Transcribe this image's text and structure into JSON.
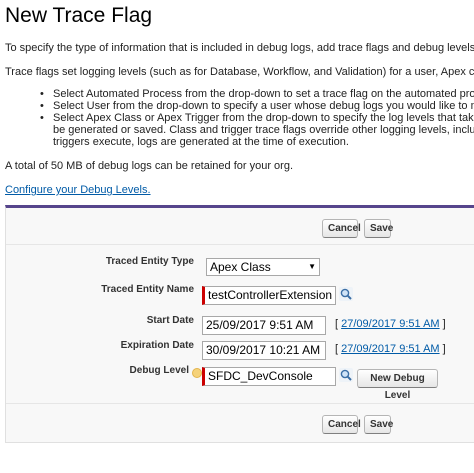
{
  "page": {
    "title": "New Trace Flag",
    "intro": "To specify the type of information that is included in debug logs, add trace flags and debug levels. Ea",
    "trace_intro": "Trace flags set logging levels (such as for Database, Workflow, and Validation) for a user, Apex class",
    "bullets": [
      "Select Automated Process from the drop-down to set a trace flag on the automated proces",
      "Select User from the drop-down to specify a user whose debug logs you would like to mor",
      "Select Apex Class or Apex Trigger from the drop-down to specify the log levels that take p",
      "be generated or saved. Class and trigger trace flags override other logging levels, includin",
      "triggers execute, logs are generated at the time of execution."
    ],
    "retention": "A total of 50 MB of debug logs can be retained for your org.",
    "configure_link": "Configure your Debug Levels."
  },
  "buttons": {
    "cancel": "Cancel",
    "save": "Save",
    "new_debug_level": "New Debug Level"
  },
  "form": {
    "traced_entity_type": {
      "label": "Traced Entity Type",
      "value": "Apex Class"
    },
    "traced_entity_name": {
      "label": "Traced Entity Name",
      "value": "testControllerExtension"
    },
    "start_date": {
      "label": "Start Date",
      "value": "25/09/2017 9:51 AM",
      "shortcut": "27/09/2017 9:51 AM"
    },
    "expiration_date": {
      "label": "Expiration Date",
      "value": "30/09/2017 10:21 AM",
      "shortcut": "27/09/2017 9:51 AM"
    },
    "debug_level": {
      "label": "Debug Level",
      "value": "SFDC_DevConsole"
    }
  },
  "colors": {
    "accent": "#56458c",
    "link": "#015ba7",
    "required": "#cc0000"
  }
}
